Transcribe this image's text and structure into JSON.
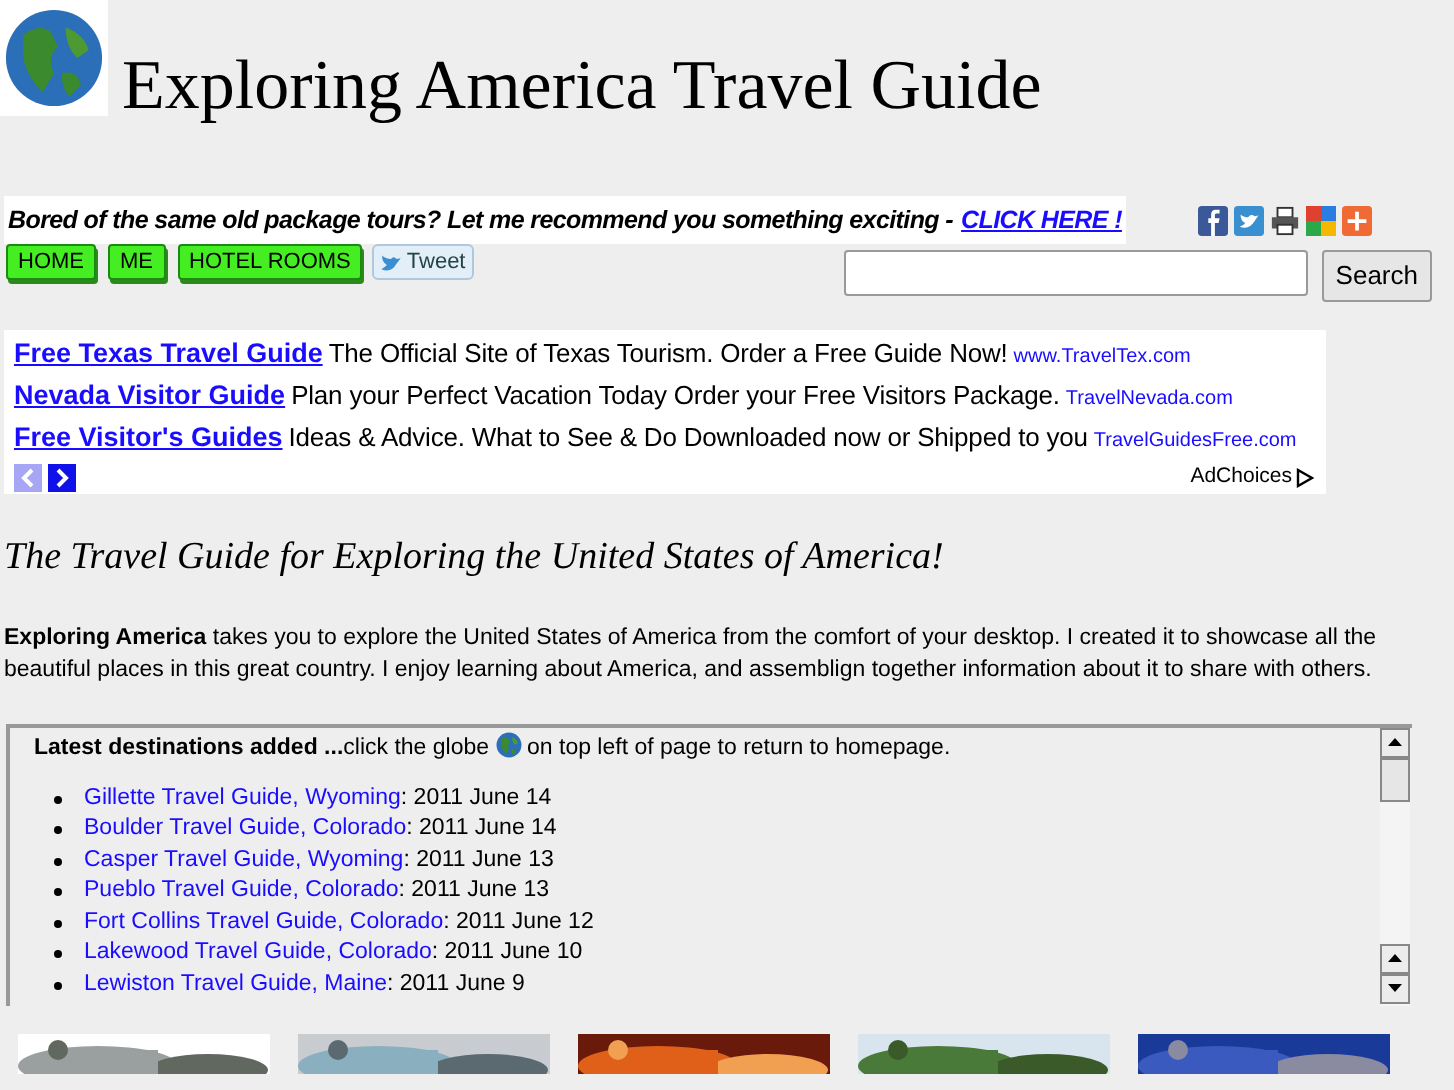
{
  "site_title": "Exploring America Travel Guide",
  "tagline": {
    "text": "Bored of the same old package tours?  Let me recommend you something exciting - ",
    "link": "CLICK HERE !"
  },
  "nav": [
    "HOME",
    "ME",
    "HOTEL ROOMS"
  ],
  "tweet": "Tweet",
  "search": {
    "button": "Search"
  },
  "ads": [
    {
      "title": "Free Texas Travel Guide",
      "text": "The Official Site of Texas Tourism. Order a Free Guide Now!",
      "url": "www.TravelTex.com"
    },
    {
      "title": "Nevada Visitor Guide",
      "text": "Plan your Perfect Vacation Today Order your Free Visitors Package.",
      "url": "TravelNevada.com"
    },
    {
      "title": "Free Visitor's Guides",
      "text": "Ideas & Advice. What to See & Do Downloaded now or Shipped to you",
      "url": "TravelGuidesFree.com"
    }
  ],
  "ad_nav": [
    {
      "kind": "prev",
      "disabled": true
    },
    {
      "kind": "next",
      "disabled": false
    }
  ],
  "adchoices": "AdChoices",
  "heading": "The Travel Guide for Exploring the United States of America!",
  "intro": "**Exploring America** takes you to explore the United States of America from the comfort of your desktop. I created it to showcase all the beautiful places in this great country. I enjoy learning about America, and assemblign together information about it to share with others.",
  "latest": {
    "lead": "Latest destinations added ...",
    "before_globe": " click the globe",
    "after_globe": " on top left of page to return to homepage.",
    "items": [
      {
        "link": "Gillette Travel Guide, Wyoming",
        "date": ": 2011 June 14"
      },
      {
        "link": "Boulder Travel Guide, Colorado",
        "date": ": 2011 June 14"
      },
      {
        "link": "Casper Travel Guide, Wyoming",
        "date": ": 2011 June 13"
      },
      {
        "link": "Pueblo Travel Guide, Colorado",
        "date": ": 2011 June 13"
      },
      {
        "link": "Fort Collins Travel Guide, Colorado",
        "date": ": 2011 June 12"
      },
      {
        "link": "Lakewood Travel Guide, Colorado",
        "date": ": 2011 June 10"
      },
      {
        "link": "Lewiston Travel Guide, Maine",
        "date": ": 2011 June 9"
      }
    ]
  }
}
